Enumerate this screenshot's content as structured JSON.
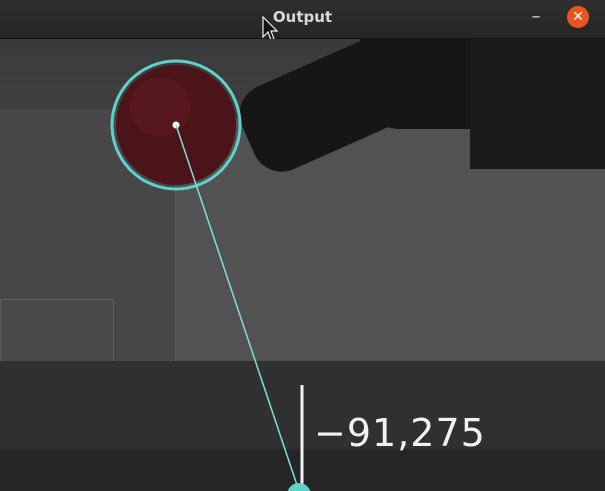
{
  "window": {
    "title": "Output",
    "minimize_glyph": "–",
    "close_glyph": "✕",
    "close_color": "#e95420"
  },
  "overlay": {
    "tracked_object": "red ball",
    "circle_color": "#5fd0cc",
    "line_color": "#7ee0dc",
    "readout": "−91,275"
  }
}
